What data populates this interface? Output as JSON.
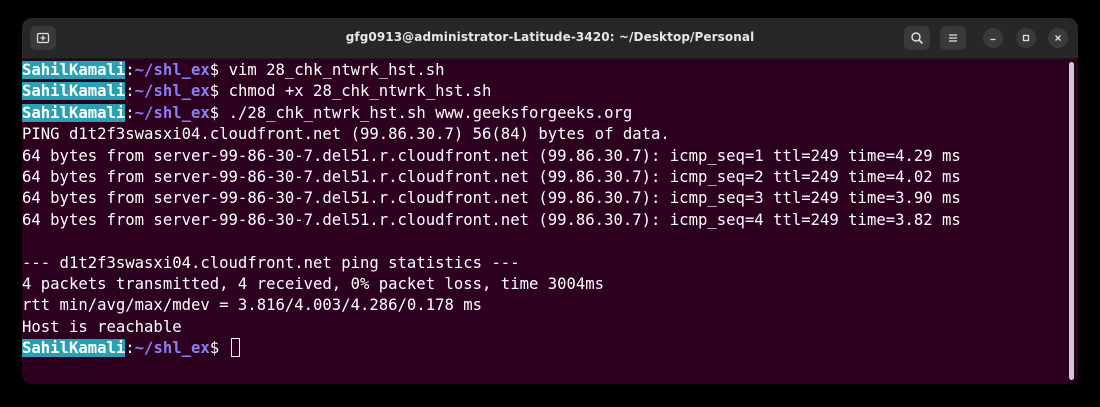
{
  "window": {
    "title": "gfg0913@administrator-Latitude-3420: ~/Desktop/Personal"
  },
  "icons": {
    "new_tab": "new-tab-icon",
    "search": "search-icon",
    "menu": "hamburger-menu-icon",
    "minimize": "minimize-icon",
    "maximize": "maximize-icon",
    "close": "close-icon"
  },
  "colors": {
    "terminal_bg": "#2c001e",
    "user_highlight": "#2aa1b3",
    "path": "#8b80f0",
    "titlebar": "#272727"
  },
  "prompt": {
    "user": "SahilKamali",
    "sep": ":",
    "path": "~/shl_ex",
    "symbol": "$ "
  },
  "terminal": {
    "cmd1": "vim 28_chk_ntwrk_hst.sh",
    "cmd2": "chmod +x 28_chk_ntwrk_hst.sh",
    "cmd3": "./28_chk_ntwrk_hst.sh www.geeksforgeeks.org",
    "output": [
      "PING d1t2f3swasxi04.cloudfront.net (99.86.30.7) 56(84) bytes of data.",
      "64 bytes from server-99-86-30-7.del51.r.cloudfront.net (99.86.30.7): icmp_seq=1 ttl=249 time=4.29 ms",
      "64 bytes from server-99-86-30-7.del51.r.cloudfront.net (99.86.30.7): icmp_seq=2 ttl=249 time=4.02 ms",
      "64 bytes from server-99-86-30-7.del51.r.cloudfront.net (99.86.30.7): icmp_seq=3 ttl=249 time=3.90 ms",
      "64 bytes from server-99-86-30-7.del51.r.cloudfront.net (99.86.30.7): icmp_seq=4 ttl=249 time=3.82 ms",
      "",
      "--- d1t2f3swasxi04.cloudfront.net ping statistics ---",
      "4 packets transmitted, 4 received, 0% packet loss, time 3004ms",
      "rtt min/avg/max/mdev = 3.816/4.003/4.286/0.178 ms",
      "Host is reachable"
    ]
  }
}
